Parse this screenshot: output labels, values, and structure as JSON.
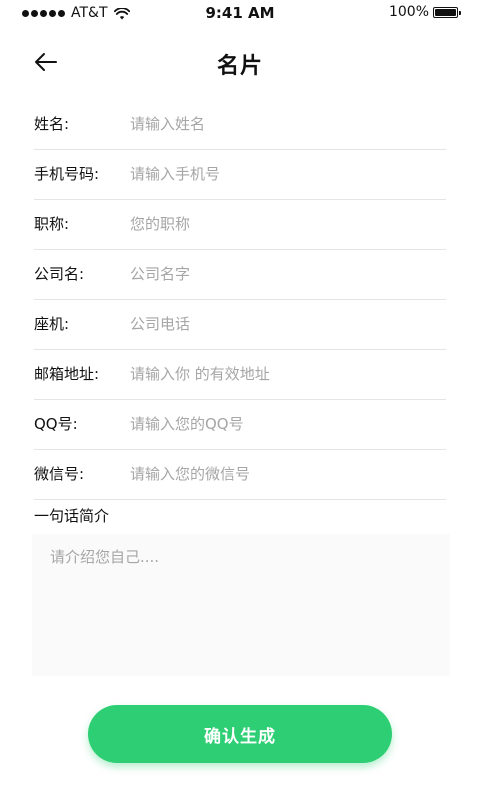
{
  "status_bar": {
    "carrier": "AT&T",
    "time": "9:41 AM",
    "battery": "100%"
  },
  "nav": {
    "title": "名片",
    "back_icon": "arrow-left-icon"
  },
  "form": {
    "fields": [
      {
        "label": "姓名:",
        "placeholder": "请输入姓名",
        "value": ""
      },
      {
        "label": "手机号码:",
        "placeholder": "请输入手机号",
        "value": ""
      },
      {
        "label": "职称:",
        "placeholder": "您的职称",
        "value": ""
      },
      {
        "label": "公司名:",
        "placeholder": "公司名字",
        "value": ""
      },
      {
        "label": "座机:",
        "placeholder": "公司电话",
        "value": ""
      },
      {
        "label": "邮箱地址:",
        "placeholder": "请输入你 的有效地址",
        "value": ""
      },
      {
        "label": "QQ号:",
        "placeholder": "请输入您的QQ号",
        "value": ""
      },
      {
        "label": "微信号:",
        "placeholder": "请输入您的微信号",
        "value": ""
      }
    ],
    "intro": {
      "label": "一句话简介",
      "placeholder": "请介绍您自己...."
    }
  },
  "confirm_button": {
    "label": "确认生成",
    "color": "#2ecf74"
  }
}
